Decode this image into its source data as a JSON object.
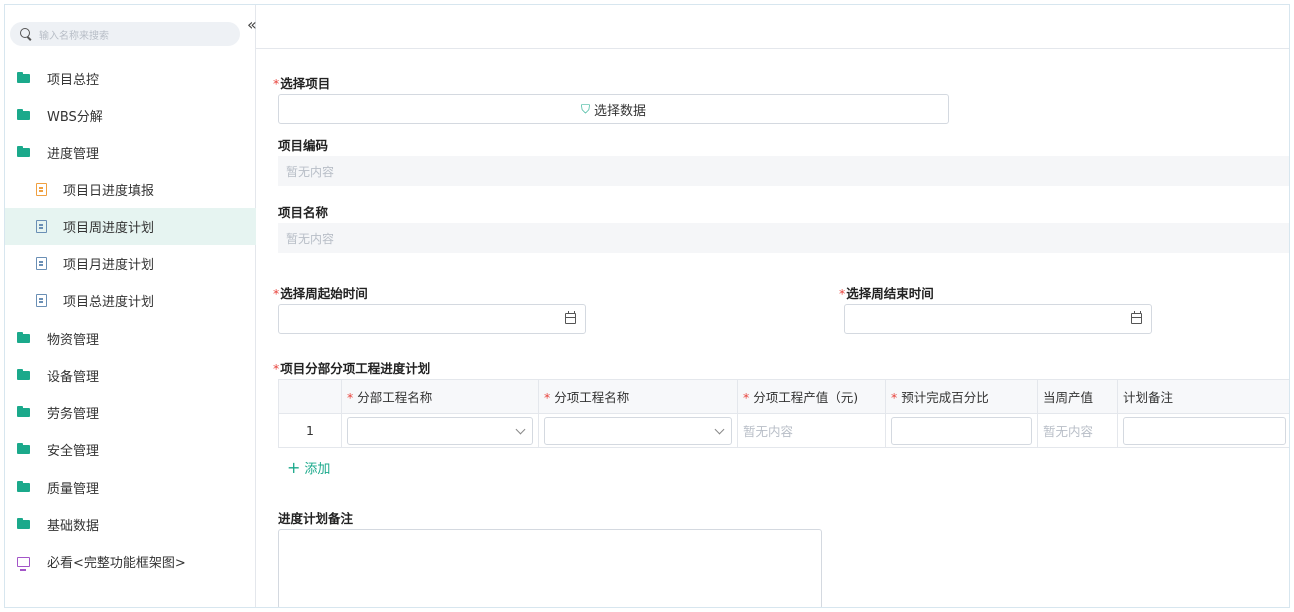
{
  "sidebar": {
    "search_placeholder": "输入名称来搜索",
    "collapse_glyph": "«",
    "items": [
      {
        "label": "项目总控"
      },
      {
        "label": "WBS分解"
      },
      {
        "label": "进度管理"
      },
      {
        "label": "项目日进度填报"
      },
      {
        "label": "项目周进度计划"
      },
      {
        "label": "项目月进度计划"
      },
      {
        "label": "项目总进度计划"
      },
      {
        "label": "物资管理"
      },
      {
        "label": "设备管理"
      },
      {
        "label": "劳务管理"
      },
      {
        "label": "安全管理"
      },
      {
        "label": "质量管理"
      },
      {
        "label": "基础数据"
      },
      {
        "label": "必看<完整功能框架图>"
      }
    ]
  },
  "form": {
    "select_project_label": "选择项目",
    "select_data_button": "选择数据",
    "project_code_label": "项目编码",
    "project_code_value": "暂无内容",
    "project_name_label": "项目名称",
    "project_name_value": "暂无内容",
    "week_start_label": "选择周起始时间",
    "week_end_label": "选择周结束时间",
    "plan_table_label": "项目分部分项工程进度计划",
    "remarks_label": "进度计划备注",
    "add_label": "添加"
  },
  "table": {
    "headers": [
      "分部工程名称",
      "分项工程名称",
      "分项工程产值（元)",
      "预计完成百分比",
      "当周产值",
      "计划备注"
    ],
    "rows": [
      {
        "index": "1",
        "output_value": "暂无内容",
        "weekly_value": "暂无内容"
      }
    ]
  }
}
